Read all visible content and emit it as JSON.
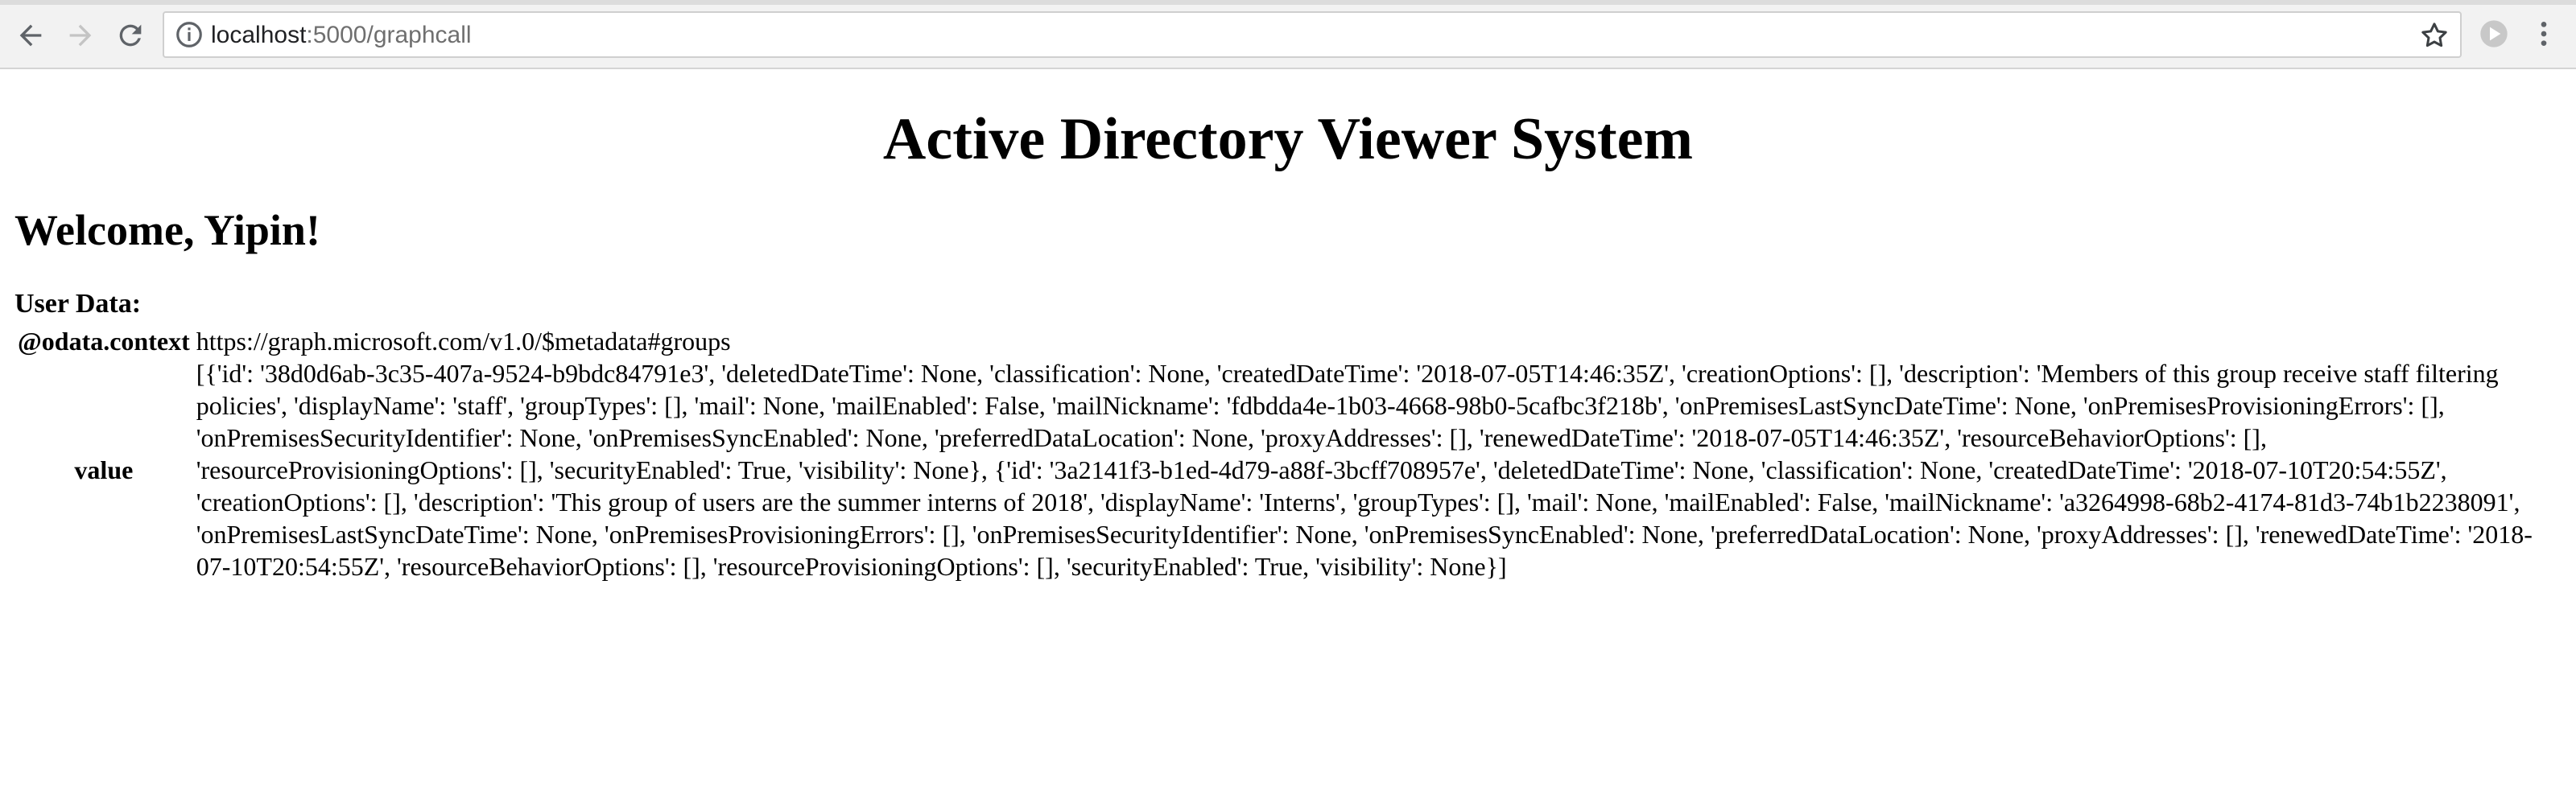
{
  "browser": {
    "url_host": "localhost",
    "url_rest": ":5000/graphcall",
    "icons": {
      "back": "arrow-left-icon",
      "forward": "arrow-right-icon",
      "reload": "reload-icon",
      "info": "info-icon",
      "bookmark": "star-icon",
      "extension": "extension-icon",
      "menu": "vertical-dots-icon"
    }
  },
  "page": {
    "title": "Active Directory Viewer System",
    "welcome": "Welcome, Yipin!",
    "user_data_label": "User Data:",
    "rows": [
      {
        "key": "@odata.context",
        "value": "https://graph.microsoft.com/v1.0/$metadata#groups"
      },
      {
        "key": "value",
        "value": "[{'id': '38d0d6ab-3c35-407a-9524-b9bdc84791e3', 'deletedDateTime': None, 'classification': None, 'createdDateTime': '2018-07-05T14:46:35Z', 'creationOptions': [], 'description': 'Members of this group receive staff filtering policies', 'displayName': 'staff', 'groupTypes': [], 'mail': None, 'mailEnabled': False, 'mailNickname': 'fdbdda4e-1b03-4668-98b0-5cafbc3f218b', 'onPremisesLastSyncDateTime': None, 'onPremisesProvisioningErrors': [], 'onPremisesSecurityIdentifier': None, 'onPremisesSyncEnabled': None, 'preferredDataLocation': None, 'proxyAddresses': [], 'renewedDateTime': '2018-07-05T14:46:35Z', 'resourceBehaviorOptions': [], 'resourceProvisioningOptions': [], 'securityEnabled': True, 'visibility': None}, {'id': '3a2141f3-b1ed-4d79-a88f-3bcff708957e', 'deletedDateTime': None, 'classification': None, 'createdDateTime': '2018-07-10T20:54:55Z', 'creationOptions': [], 'description': 'This group of users are the summer interns of 2018', 'displayName': 'Interns', 'groupTypes': [], 'mail': None, 'mailEnabled': False, 'mailNickname': 'a3264998-68b2-4174-81d3-74b1b2238091', 'onPremisesLastSyncDateTime': None, 'onPremisesProvisioningErrors': [], 'onPremisesSecurityIdentifier': None, 'onPremisesSyncEnabled': None, 'preferredDataLocation': None, 'proxyAddresses': [], 'renewedDateTime': '2018-07-10T20:54:55Z', 'resourceBehaviorOptions': [], 'resourceProvisioningOptions': [], 'securityEnabled': True, 'visibility': None}]"
      }
    ]
  }
}
